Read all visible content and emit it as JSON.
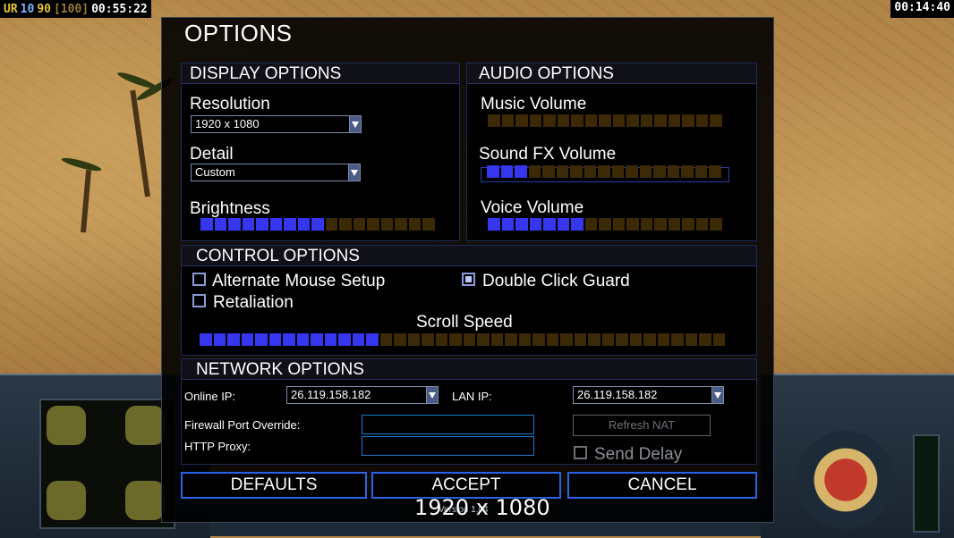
{
  "hud": {
    "ur": "UR",
    "v1": "10",
    "v2": "90",
    "v3": "[100]",
    "timer_left": "00:55:22",
    "timer_right": "00:14:40"
  },
  "options": {
    "title": "OPTIONS",
    "display": {
      "heading": "DISPLAY OPTIONS",
      "resolution_label": "Resolution",
      "resolution_value": "1920 x 1080",
      "detail_label": "Detail",
      "detail_value": "Custom",
      "brightness_label": "Brightness",
      "brightness_level": 0.5
    },
    "audio": {
      "heading": "AUDIO OPTIONS",
      "music_label": "Music Volume",
      "music_level": 0,
      "sfx_label": "Sound FX Volume",
      "sfx_level": 0.2,
      "voice_label": "Voice Volume",
      "voice_level": 0.4
    },
    "control": {
      "heading": "CONTROL OPTIONS",
      "alt_mouse_label": "Alternate Mouse Setup",
      "alt_mouse_checked": false,
      "double_click_label": "Double Click Guard",
      "double_click_checked": true,
      "retaliation_label": "Retaliation",
      "retaliation_checked": false,
      "scroll_label": "Scroll Speed",
      "scroll_level": 0.33
    },
    "network": {
      "heading": "NETWORK OPTIONS",
      "online_ip_label": "Online IP:",
      "online_ip_value": "26.119.158.182",
      "lan_ip_label": "LAN IP:",
      "lan_ip_value": "26.119.158.182",
      "firewall_label": "Firewall Port Override:",
      "firewall_value": "",
      "proxy_label": "HTTP Proxy:",
      "proxy_value": "",
      "refresh_nat_label": "Refresh NAT",
      "send_delay_label": "Send Delay",
      "send_delay_checked": false
    },
    "buttons": {
      "defaults": "DEFAULTS",
      "accept": "ACCEPT",
      "cancel": "CANCEL"
    },
    "version": "Version 1.04"
  },
  "overlay_resolution": "1920 x 1080",
  "colors": {
    "segment_on": "#3636ee",
    "segment_off": "#3b2a05",
    "button_border": "#2b62e6"
  }
}
